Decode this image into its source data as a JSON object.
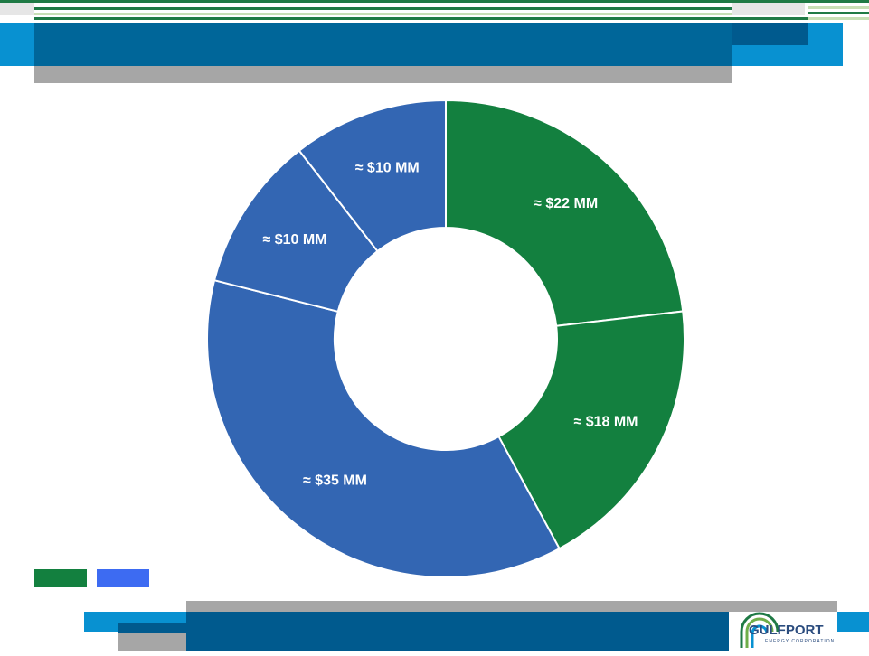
{
  "theme": {
    "green_stripe": "#1f7a45",
    "light_green": "#c7dfb5",
    "light_gray": "#e6e6e6",
    "blue_light": "#0891d1",
    "blue_mid": "#007ab8",
    "blue_dark": "#005a8e",
    "gray_bar": "#a6a6a6",
    "slice_green": "#13803f",
    "slice_blue": "#3366b3",
    "legend_blue": "#3d6bf2"
  },
  "logo": {
    "name": "GULFPORT",
    "tagline": "ENERGY CORPORATION"
  },
  "chart_data": {
    "type": "pie",
    "donut": true,
    "slices": [
      {
        "label": "≈ $22 MM",
        "value": 22,
        "group": "green"
      },
      {
        "label": "≈ $18 MM",
        "value": 18,
        "group": "green"
      },
      {
        "label": "≈ $35 MM",
        "value": 35,
        "group": "blue"
      },
      {
        "label": "≈ $10 MM",
        "value": 10,
        "group": "blue"
      },
      {
        "label": "≈ $10 MM",
        "value": 10,
        "group": "blue"
      }
    ],
    "legend": {
      "placement": "bottom-left",
      "entries": [
        "green",
        "blue"
      ]
    }
  }
}
